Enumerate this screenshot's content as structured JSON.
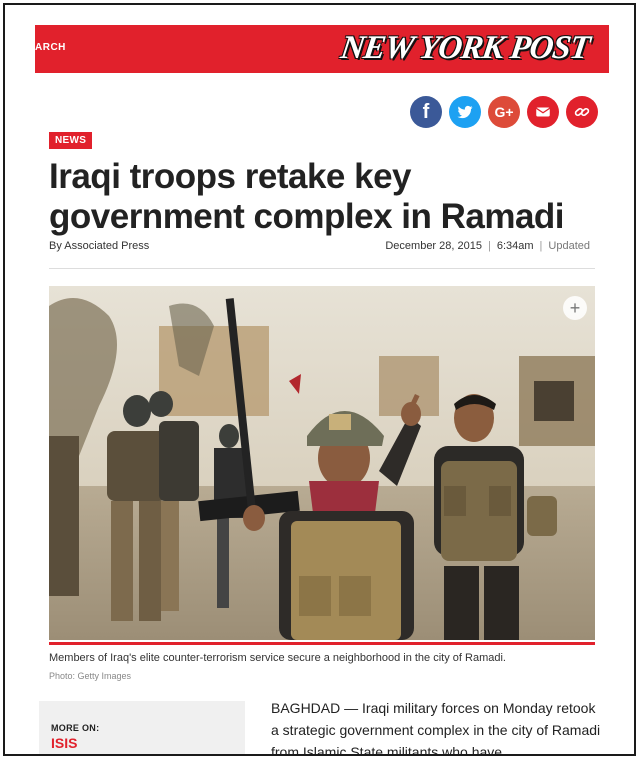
{
  "header": {
    "search_label": "ARCH",
    "logo": "NEW YORK POST",
    "brand_color": "#e1212c"
  },
  "share": {
    "items": [
      {
        "name": "facebook",
        "glyph": "f",
        "color": "#3b5998"
      },
      {
        "name": "twitter",
        "glyph": "",
        "color": "#1da1f2"
      },
      {
        "name": "google-plus",
        "glyph": "G+",
        "color": "#dd4b39"
      },
      {
        "name": "email",
        "glyph": "",
        "color": "#e1212c"
      },
      {
        "name": "link",
        "glyph": "",
        "color": "#e1212c"
      }
    ]
  },
  "article": {
    "section": "NEWS",
    "headline": "Iraqi troops retake key government complex in Ramadi",
    "byline": "By Associated Press",
    "date": "December 28, 2015",
    "time": "6:34am",
    "updated": "Updated",
    "caption": "Members of Iraq's elite counter-terrorism service secure a neighborhood in the city of Ramadi.",
    "credit": "Photo: Getty Images",
    "body": "BAGHDAD — Iraqi military forces on Monday retook a strategic government complex in the city of Ramadi from Islamic State militants who have"
  },
  "more_on": {
    "label": "MORE ON:",
    "topic": "ISIS"
  }
}
